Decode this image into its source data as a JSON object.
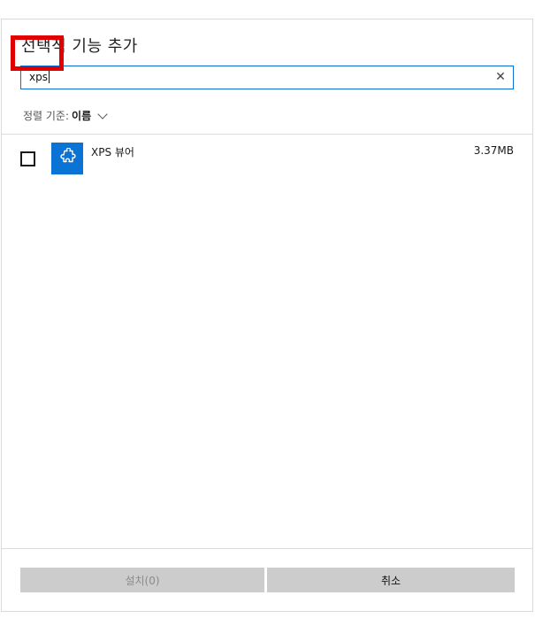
{
  "dialog": {
    "title": "선택적 기능 추가"
  },
  "search": {
    "value": "xps",
    "clear_icon": "close-icon",
    "clear_glyph": "✕"
  },
  "sort": {
    "label": "정렬 기준:",
    "value": "이름"
  },
  "features": [
    {
      "name": "XPS 뷰어",
      "size": "3.37MB",
      "checked": false,
      "icon": "puzzle-piece-icon"
    }
  ],
  "buttons": {
    "install_label": "설치(0)",
    "cancel_label": "취소"
  },
  "colors": {
    "accent": "#0a73d4",
    "highlight": "#e00000",
    "button_bg": "#cccccc"
  }
}
